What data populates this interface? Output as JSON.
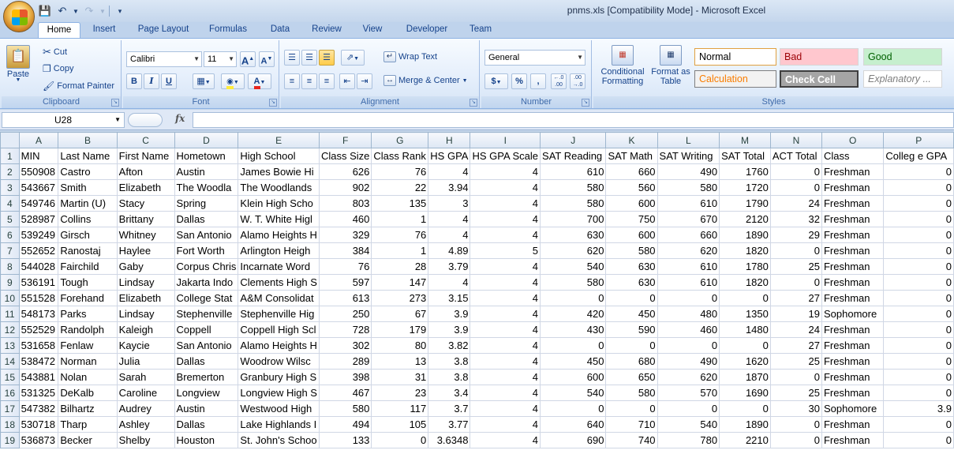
{
  "window": {
    "title": "pnms.xls  [Compatibility Mode] - Microsoft Excel"
  },
  "ribbon": {
    "tabs": [
      "Home",
      "Insert",
      "Page Layout",
      "Formulas",
      "Data",
      "Review",
      "View",
      "Developer",
      "Team"
    ],
    "active_tab": "Home",
    "clipboard": {
      "label": "Clipboard",
      "paste": "Paste",
      "cut": "Cut",
      "copy": "Copy",
      "format_painter": "Format Painter"
    },
    "font": {
      "label": "Font",
      "family": "Calibri",
      "size": "11",
      "bold": "B",
      "italic": "I",
      "underline": "U",
      "grow": "A",
      "shrink": "A",
      "font_color": "#e8261e",
      "fill_color": "#ffeb3b"
    },
    "alignment": {
      "label": "Alignment",
      "wrap_text": "Wrap Text",
      "merge_center": "Merge & Center"
    },
    "number": {
      "label": "Number",
      "format": "General",
      "currency": "$",
      "percent": "%",
      "comma": ",",
      "inc_decimal": ".00→.0",
      "dec_decimal": ".0→.00"
    },
    "styles": {
      "label": "Styles",
      "conditional": "Conditional Formatting",
      "format_table": "Format as Table",
      "cells": [
        {
          "name": "Normal",
          "bg": "#ffffff",
          "color": "#000000",
          "border": "#e0a040"
        },
        {
          "name": "Bad",
          "bg": "#ffc7ce",
          "color": "#9c0006",
          "border": "#d6d6d6"
        },
        {
          "name": "Good",
          "bg": "#c6efce",
          "color": "#006100",
          "border": "#d6d6d6"
        },
        {
          "name": "Calculation",
          "bg": "#f2f2f2",
          "color": "#fa7d00",
          "border": "#7f7f7f"
        },
        {
          "name": "Check Cell",
          "bg": "#a5a5a5",
          "color": "#ffffff",
          "border": "#3f3f3f"
        },
        {
          "name": "Explanatory ...",
          "bg": "#ffffff",
          "color": "#7f7f7f",
          "border": "#d6d6d6"
        }
      ]
    }
  },
  "formula_bar": {
    "name_box": "U28",
    "fx": "fx",
    "value": ""
  },
  "sheet": {
    "column_letters": [
      "A",
      "B",
      "C",
      "D",
      "E",
      "F",
      "G",
      "H",
      "I",
      "J",
      "K",
      "L",
      "M",
      "N",
      "O",
      "P"
    ],
    "header_row": [
      "MIN",
      "Last Name",
      "First Name",
      "Hometown",
      "High School",
      "Class Size",
      "Class Rank",
      "HS GPA",
      "HS GPA Scale",
      "SAT Reading",
      "SAT Math",
      "SAT Writing",
      "SAT Total",
      "ACT Total",
      "Class",
      "Colleg e GPA"
    ],
    "rows": [
      [
        "550908",
        "Castro",
        "Afton",
        "Austin",
        "James Bowie Hi",
        "626",
        "76",
        "4",
        "4",
        "610",
        "660",
        "490",
        "1760",
        "0",
        "Freshman",
        "0"
      ],
      [
        "543667",
        "Smith",
        "Elizabeth",
        "The Woodla",
        "The Woodlands",
        "902",
        "22",
        "3.94",
        "4",
        "580",
        "560",
        "580",
        "1720",
        "0",
        "Freshman",
        "0"
      ],
      [
        "549746",
        "Martin (U)",
        "Stacy",
        "Spring",
        "Klein High Scho",
        "803",
        "135",
        "3",
        "4",
        "580",
        "600",
        "610",
        "1790",
        "24",
        "Freshman",
        "0"
      ],
      [
        "528987",
        "Collins",
        "Brittany",
        "Dallas",
        "W. T. White Higl",
        "460",
        "1",
        "4",
        "4",
        "700",
        "750",
        "670",
        "2120",
        "32",
        "Freshman",
        "0"
      ],
      [
        "539249",
        "Girsch",
        "Whitney",
        "San Antonio",
        "Alamo Heights H",
        "329",
        "76",
        "4",
        "4",
        "630",
        "600",
        "660",
        "1890",
        "29",
        "Freshman",
        "0"
      ],
      [
        "552652",
        "Ranostaj",
        "Haylee",
        "Fort Worth",
        "Arlington Heigh",
        "384",
        "1",
        "4.89",
        "5",
        "620",
        "580",
        "620",
        "1820",
        "0",
        "Freshman",
        "0"
      ],
      [
        "544028",
        "Fairchild",
        "Gaby",
        "Corpus Chris",
        "Incarnate Word",
        "76",
        "28",
        "3.79",
        "4",
        "540",
        "630",
        "610",
        "1780",
        "25",
        "Freshman",
        "0"
      ],
      [
        "536191",
        "Tough",
        "Lindsay",
        "Jakarta Indo",
        "Clements High S",
        "597",
        "147",
        "4",
        "4",
        "580",
        "630",
        "610",
        "1820",
        "0",
        "Freshman",
        "0"
      ],
      [
        "551528",
        "Forehand",
        "Elizabeth",
        "College Stat",
        "A&M Consolidat",
        "613",
        "273",
        "3.15",
        "4",
        "0",
        "0",
        "0",
        "0",
        "27",
        "Freshman",
        "0"
      ],
      [
        "548173",
        "Parks",
        "Lindsay",
        "Stephenville",
        "Stephenville Hig",
        "250",
        "67",
        "3.9",
        "4",
        "420",
        "450",
        "480",
        "1350",
        "19",
        "Sophomore",
        "0"
      ],
      [
        "552529",
        "Randolph",
        "Kaleigh",
        "Coppell",
        "Coppell High Scl",
        "728",
        "179",
        "3.9",
        "4",
        "430",
        "590",
        "460",
        "1480",
        "24",
        "Freshman",
        "0"
      ],
      [
        "531658",
        "Fenlaw",
        "Kaycie",
        "San Antonio",
        "Alamo Heights H",
        "302",
        "80",
        "3.82",
        "4",
        "0",
        "0",
        "0",
        "0",
        "27",
        "Freshman",
        "0"
      ],
      [
        "538472",
        "Norman",
        "Julia",
        "Dallas",
        "Woodrow Wilsc",
        "289",
        "13",
        "3.8",
        "4",
        "450",
        "680",
        "490",
        "1620",
        "25",
        "Freshman",
        "0"
      ],
      [
        "543881",
        "Nolan",
        "Sarah",
        "Bremerton",
        "Granbury High S",
        "398",
        "31",
        "3.8",
        "4",
        "600",
        "650",
        "620",
        "1870",
        "0",
        "Freshman",
        "0"
      ],
      [
        "531325",
        "DeKalb",
        "Caroline",
        "Longview",
        "Longview High S",
        "467",
        "23",
        "3.4",
        "4",
        "540",
        "580",
        "570",
        "1690",
        "25",
        "Freshman",
        "0"
      ],
      [
        "547382",
        "Bilhartz",
        "Audrey",
        "Austin",
        "Westwood High",
        "580",
        "117",
        "3.7",
        "4",
        "0",
        "0",
        "0",
        "0",
        "30",
        "Sophomore",
        "3.9"
      ],
      [
        "530718",
        "Tharp",
        "Ashley",
        "Dallas",
        "Lake Highlands I",
        "494",
        "105",
        "3.77",
        "4",
        "640",
        "710",
        "540",
        "1890",
        "0",
        "Freshman",
        "0"
      ],
      [
        "536873",
        "Becker",
        "Shelby",
        "Houston",
        "St. John's Schoo",
        "133",
        "0",
        "3.6348",
        "4",
        "690",
        "740",
        "780",
        "2210",
        "0",
        "Freshman",
        "0"
      ]
    ]
  }
}
